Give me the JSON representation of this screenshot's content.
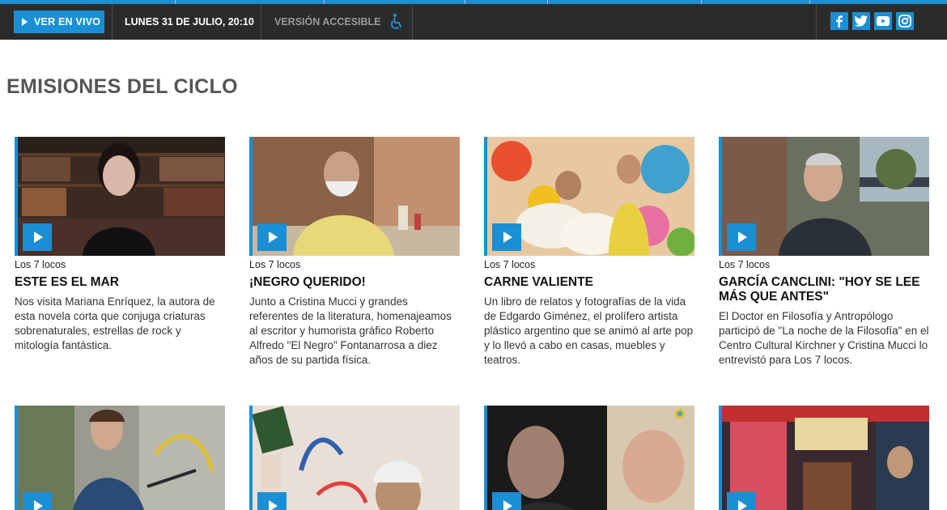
{
  "header": {
    "live_label": "VER EN VIVO",
    "date_label": "LUNES 31 DE JULIO, 20:10",
    "accessible_label": "VERSIÓN ACCESIBLE",
    "accent_color": "#1a8fd6",
    "social": [
      "facebook-icon",
      "twitter-icon",
      "youtube-icon",
      "instagram-icon"
    ]
  },
  "section": {
    "title": "EMISIONES DEL CICLO"
  },
  "cards": [
    {
      "category": "Los 7 locos",
      "title": "ESTE ES EL MAR",
      "description": "Nos visita Mariana Enríquez, la autora de esta novela corta que conjuga criaturas sobrenaturales, estrellas de rock y mitología fantástica."
    },
    {
      "category": "Los 7 locos",
      "title": "¡NEGRO QUERIDO!",
      "description": "Junto a Cristina Mucci y grandes referentes de la literatura, homenajeamos al escritor y humorista gráfico Roberto Alfredo \"El Negro\" Fontanarrosa a diez años de su partida física."
    },
    {
      "category": "Los 7 locos",
      "title": "CARNE VALIENTE",
      "description": "Un libro de relatos y fotografías de la vida de Edgardo Giménez, el prolífero artista plástico argentino que se animó al arte pop y lo llevó a cabo en casas, muebles y teatros."
    },
    {
      "category": "Los 7 locos",
      "title": "GARCÍA CANCLINI: \"HOY SE LEE MÁS QUE ANTES\"",
      "description": "El Doctor en Filosofía y Antropólogo participó de \"La noche de la Filosofía\" en el Centro Cultural Kirchner y Cristina Mucci lo entrevistó para Los 7 locos."
    }
  ]
}
